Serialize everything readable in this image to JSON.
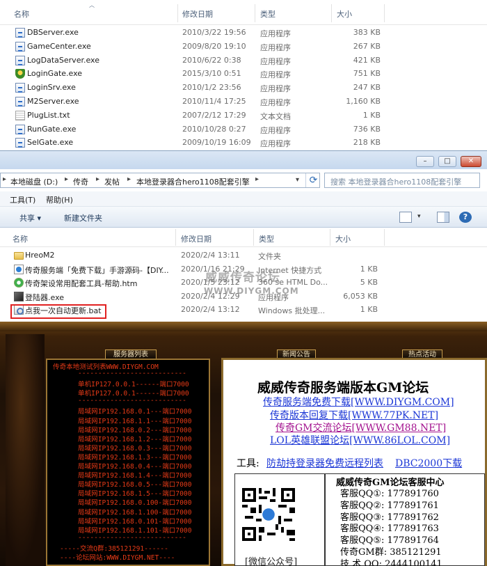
{
  "explorer1": {
    "columns": {
      "name": "名称",
      "modified": "修改日期",
      "type": "类型",
      "size": "大小"
    },
    "files": [
      {
        "name": "DBServer.exe",
        "date": "2010/3/22 19:56",
        "type": "应用程序",
        "size": "383 KB",
        "icon": "exe-icon"
      },
      {
        "name": "GameCenter.exe",
        "date": "2009/8/20 19:10",
        "type": "应用程序",
        "size": "267 KB",
        "icon": "exe-icon"
      },
      {
        "name": "LogDataServer.exe",
        "date": "2010/6/22 0:38",
        "type": "应用程序",
        "size": "421 KB",
        "icon": "exe-icon"
      },
      {
        "name": "LoginGate.exe",
        "date": "2015/3/10 0:51",
        "type": "应用程序",
        "size": "751 KB",
        "icon": "shield-icon"
      },
      {
        "name": "LoginSrv.exe",
        "date": "2010/1/2 23:56",
        "type": "应用程序",
        "size": "247 KB",
        "icon": "exe-icon"
      },
      {
        "name": "M2Server.exe",
        "date": "2010/11/4 17:25",
        "type": "应用程序",
        "size": "1,160 KB",
        "icon": "exe-icon"
      },
      {
        "name": "PlugList.txt",
        "date": "2007/2/12 17:29",
        "type": "文本文档",
        "size": "1 KB",
        "icon": "text-file-icon"
      },
      {
        "name": "RunGate.exe",
        "date": "2010/10/28 0:27",
        "type": "应用程序",
        "size": "736 KB",
        "icon": "exe-icon"
      },
      {
        "name": "SelGate.exe",
        "date": "2009/10/19 16:09",
        "type": "应用程序",
        "size": "218 KB",
        "icon": "exe-icon"
      }
    ]
  },
  "explorer2": {
    "window_buttons": {
      "minimize": "–",
      "maximize": "□",
      "close": "✕"
    },
    "breadcrumb": [
      "本地磁盘 (D:)",
      "传奇",
      "发帖",
      "本地登录器合hero1108配套引擎"
    ],
    "search_placeholder": "搜索 本地登录器合hero1108配套引擎",
    "menu": {
      "tools": "工具(T)",
      "help": "帮助(H)"
    },
    "toolbar": {
      "share": "共享 ▾",
      "new_folder": "新建文件夹"
    },
    "columns": {
      "name": "名称",
      "modified": "修改日期",
      "type": "类型",
      "size": "大小"
    },
    "files": [
      {
        "name": "HreoM2",
        "date": "2020/2/4 13:11",
        "type": "文件夹",
        "size": "",
        "icon": "folder-icon"
      },
      {
        "name": "传奇服务端「免费下载」手游源码-【DIY...",
        "date": "2020/1/16 21:29",
        "type": "Internet 快捷方式",
        "size": "1 KB",
        "icon": "url-shortcut-icon"
      },
      {
        "name": "传奇架设常用配套工具-帮助.htm",
        "date": "2020/1/5 23:12",
        "type": "360 se HTML Do...",
        "size": "5 KB",
        "icon": "html-file-icon"
      },
      {
        "name": "登陆器.exe",
        "date": "2020/2/4 12:29",
        "type": "应用程序",
        "size": "6,053 KB",
        "icon": "launcher-icon"
      },
      {
        "name": "点我一次自动更新.bat",
        "date": "2020/2/4 13:12",
        "type": "Windows 批处理...",
        "size": "1 KB",
        "icon": "batch-file-icon"
      }
    ],
    "highlight_color": "#e02020"
  },
  "watermark": {
    "line1": "威威传奇论坛",
    "line2": "WWW.DIYGM.COM"
  },
  "game": {
    "tabs": {
      "server_list": "服务器列表",
      "news": "新闻公告",
      "events": "热点活动"
    },
    "server_list_title": "传奇本地测试列表WWW.DIYGM.COM",
    "servers": [
      "---------------------------",
      "单机IP127.0.0.1------端口7000",
      "单机IP127.0.0.1------端口7000",
      "---------------------------",
      "局域网IP192.168.0.1---端口7000",
      "局域网IP192.168.1.1---端口7000",
      "局域网IP192.168.0.2---端口7000",
      "局域网IP192.168.1.2---端口7000",
      "局域网IP192.168.0.3---端口7000",
      "局域网IP192.168.1.3---端口7000",
      "局域网IP192.168.0.4---端口7000",
      "局域网IP192.168.1.4---端口7000",
      "局域网IP192.168.0.5---端口7000",
      "局域网IP192.168.1.5---端口7000",
      "局域网IP192.168.0.100-端口7000",
      "局域网IP192.168.1.100-端口7000",
      "局域网IP192.168.0.101-端口7000",
      "局域网IP192.168.1.101-端口7000",
      "---------------------------",
      "-----交流Q群:385121291------",
      "----论坛网站:WWW.DIYGM.NET----"
    ],
    "notice": {
      "title": "威威传奇服务端版本GM论坛",
      "links": [
        {
          "text": "传奇服务端免费下载[WWW.DIYGM.COM]",
          "color": "#1c37d6"
        },
        {
          "text": "传奇版本回复下载[WWW.77PK.NET]",
          "color": "#1c37d6"
        },
        {
          "text": "传奇GM交流论坛[WWW.GM88.NET]",
          "color": "#a3128f"
        },
        {
          "text": "LOL英雄联盟论坛[WWW.86LOL.COM]",
          "color": "#1c37d6"
        }
      ],
      "tools_label": "工具:",
      "tool_links": [
        "防劫持登录器免费远程列表",
        "DBC2000下载"
      ],
      "qr_caption": "[微信公众号]"
    },
    "customer_service": {
      "title": "威威传奇GM论坛客服中心",
      "lines": [
        "客服QQ①: 177891760",
        "客服QQ②: 177891761",
        "客服QQ③: 177891762",
        "客服QQ④: 177891763",
        "客服QQ⑤: 177891764",
        "传奇GM群: 385121291",
        "技 术 QQ: 2444100141"
      ]
    }
  }
}
